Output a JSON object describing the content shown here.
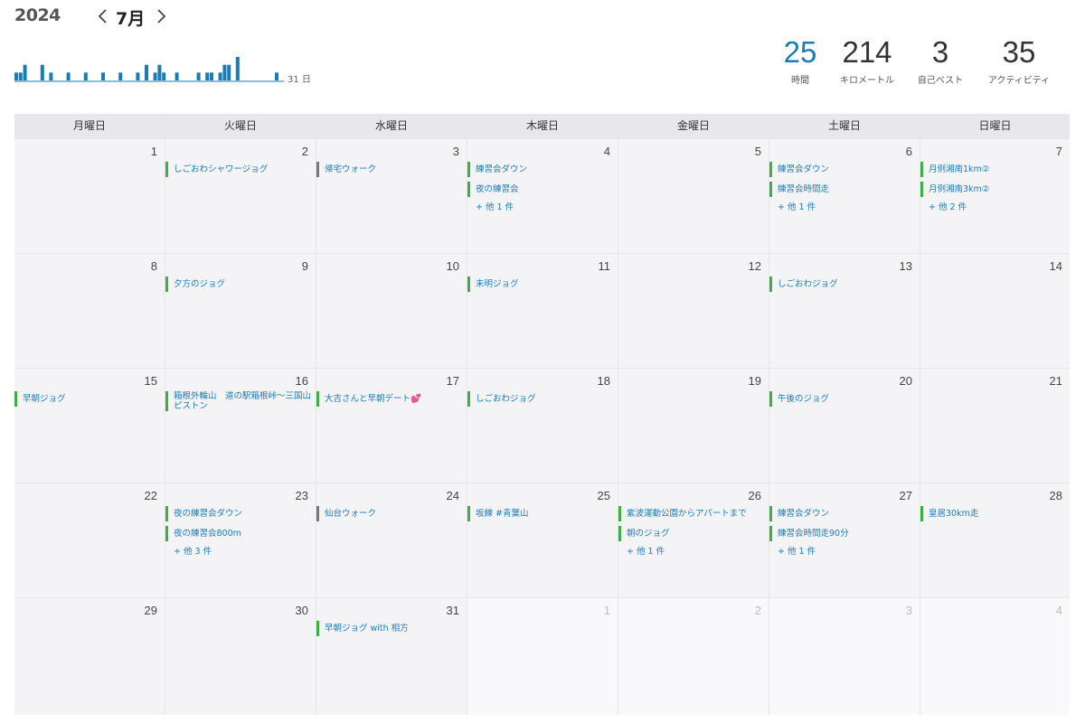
{
  "header": {
    "year": "2024",
    "month": "7月"
  },
  "histogram": {
    "days_label": "31 日",
    "values": [
      1,
      1,
      2,
      0,
      0,
      0,
      2,
      0,
      1,
      0,
      0,
      0,
      1,
      0,
      0,
      0,
      1,
      0,
      0,
      0,
      1,
      0,
      0,
      0,
      1,
      0,
      0,
      0,
      1,
      0,
      2,
      0,
      1,
      2,
      1,
      0,
      0,
      1,
      0,
      0,
      0,
      0,
      1,
      0,
      1,
      1,
      0,
      1,
      2,
      2,
      0,
      3,
      0,
      0,
      0,
      0,
      0,
      0,
      0,
      0,
      1
    ],
    "color": "#1a7bb9"
  },
  "stats": {
    "hours": {
      "value": "25",
      "label": "時間"
    },
    "km": {
      "value": "214",
      "label": "キロメートル"
    },
    "pb": {
      "value": "3",
      "label": "自己ベスト"
    },
    "activities": {
      "value": "35",
      "label": "アクティビティ"
    }
  },
  "weekdays": [
    "月曜日",
    "火曜日",
    "水曜日",
    "木曜日",
    "金曜日",
    "土曜日",
    "日曜日"
  ],
  "weeks": [
    [
      {
        "day": "1",
        "acts": []
      },
      {
        "day": "2",
        "acts": [
          {
            "name": "しごおわシャワージョグ",
            "type": "run"
          }
        ]
      },
      {
        "day": "3",
        "acts": [
          {
            "name": "帰宅ウォーク",
            "type": "walk"
          }
        ]
      },
      {
        "day": "4",
        "acts": [
          {
            "name": "練習会ダウン",
            "type": "run"
          },
          {
            "name": "夜の練習会",
            "type": "run"
          }
        ],
        "more": "+ 他 1 件"
      },
      {
        "day": "5",
        "acts": []
      },
      {
        "day": "6",
        "acts": [
          {
            "name": "練習会ダウン",
            "type": "run"
          },
          {
            "name": "練習会時間走",
            "type": "run"
          }
        ],
        "more": "+ 他 1 件"
      },
      {
        "day": "7",
        "acts": [
          {
            "name": "月例湘南1km②",
            "type": "run"
          },
          {
            "name": "月例湘南3km②",
            "type": "run"
          }
        ],
        "more": "+ 他 2 件"
      }
    ],
    [
      {
        "day": "8",
        "acts": []
      },
      {
        "day": "9",
        "acts": [
          {
            "name": "夕方のジョグ",
            "type": "run"
          }
        ]
      },
      {
        "day": "10",
        "acts": []
      },
      {
        "day": "11",
        "acts": [
          {
            "name": "未明ジョグ",
            "type": "run"
          }
        ]
      },
      {
        "day": "12",
        "acts": []
      },
      {
        "day": "13",
        "acts": [
          {
            "name": "しごおわジョグ",
            "type": "run"
          }
        ]
      },
      {
        "day": "14",
        "acts": []
      }
    ],
    [
      {
        "day": "15",
        "acts": [
          {
            "name": "早朝ジョグ",
            "type": "run"
          }
        ]
      },
      {
        "day": "16",
        "acts": [
          {
            "name": "箱根外輪山　道の駅箱根峠〜三国山ピストン",
            "type": "run"
          }
        ]
      },
      {
        "day": "17",
        "acts": [
          {
            "name": "大吉さんと早朝デート💕",
            "type": "run"
          }
        ]
      },
      {
        "day": "18",
        "acts": [
          {
            "name": "しごおわジョグ",
            "type": "run"
          }
        ]
      },
      {
        "day": "19",
        "acts": []
      },
      {
        "day": "20",
        "acts": [
          {
            "name": "午後のジョグ",
            "type": "run"
          }
        ]
      },
      {
        "day": "21",
        "acts": []
      }
    ],
    [
      {
        "day": "22",
        "acts": []
      },
      {
        "day": "23",
        "acts": [
          {
            "name": "夜の練習会ダウン",
            "type": "run"
          },
          {
            "name": "夜の練習会800m",
            "type": "run"
          }
        ],
        "more": "+ 他 3 件"
      },
      {
        "day": "24",
        "acts": [
          {
            "name": "仙台ウォーク",
            "type": "walk"
          }
        ]
      },
      {
        "day": "25",
        "acts": [
          {
            "name": "坂練 #青葉山",
            "type": "run"
          }
        ]
      },
      {
        "day": "26",
        "acts": [
          {
            "name": "紫波運動公園からアパートまで",
            "type": "run"
          },
          {
            "name": "朝のジョグ",
            "type": "run"
          }
        ],
        "more": "+ 他 1 件"
      },
      {
        "day": "27",
        "acts": [
          {
            "name": "練習会ダウン",
            "type": "run"
          },
          {
            "name": "練習会時間走90分",
            "type": "run"
          }
        ],
        "more": "+ 他 1 件"
      },
      {
        "day": "28",
        "acts": [
          {
            "name": "皇居30km走",
            "type": "run"
          }
        ]
      }
    ],
    [
      {
        "day": "29",
        "acts": []
      },
      {
        "day": "30",
        "acts": []
      },
      {
        "day": "31",
        "acts": [
          {
            "name": "早朝ジョグ with 相方",
            "type": "run"
          }
        ]
      },
      {
        "day": "1",
        "other": true,
        "acts": []
      },
      {
        "day": "2",
        "other": true,
        "acts": []
      },
      {
        "day": "3",
        "other": true,
        "acts": []
      },
      {
        "day": "4",
        "other": true,
        "acts": []
      }
    ]
  ]
}
